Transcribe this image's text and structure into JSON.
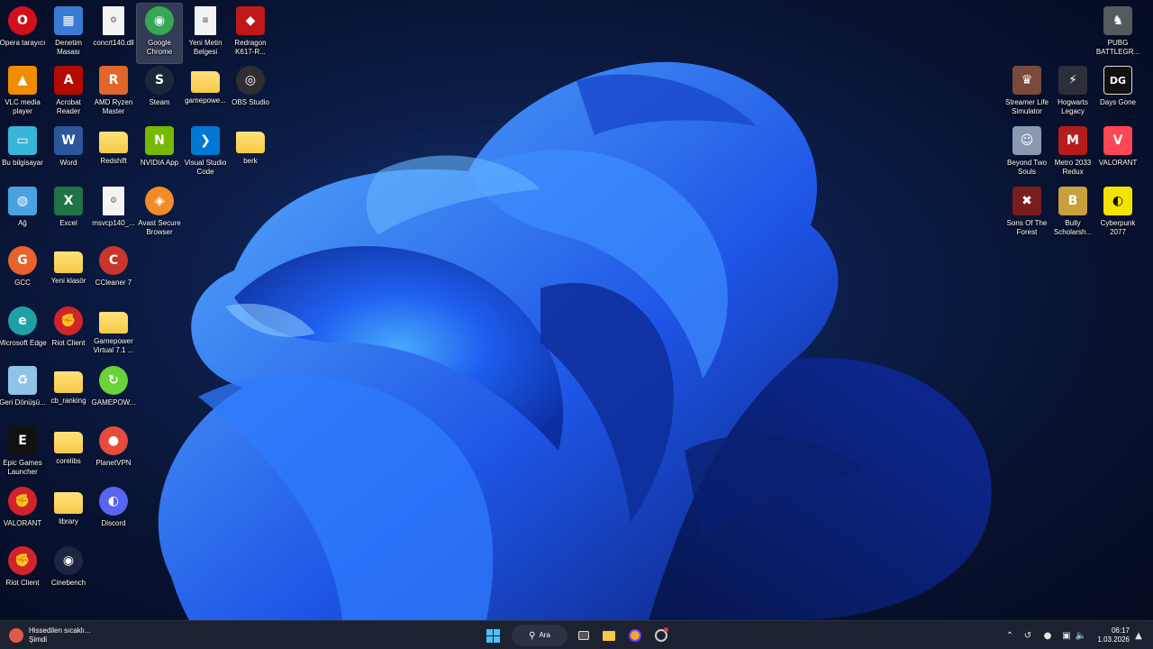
{
  "desktop": {
    "left_icons": [
      {
        "label": "Opera tarayıcı",
        "icon": "opera-icon"
      },
      {
        "label": "Denetim Masası",
        "icon": "control-panel-icon"
      },
      {
        "label": "concrt140.dll",
        "icon": "dll-file-icon"
      },
      {
        "label": "Google Chrome",
        "icon": "chrome-icon",
        "selected": true
      },
      {
        "label": "Yeni Metin Belgesi",
        "icon": "text-document-icon"
      },
      {
        "label": "Redragon K617-R...",
        "icon": "redragon-icon"
      },
      {
        "label": "VLC media player",
        "icon": "vlc-icon"
      },
      {
        "label": "Acrobat Reader",
        "icon": "acrobat-icon"
      },
      {
        "label": "AMD Ryzen Master",
        "icon": "amd-ryzen-icon"
      },
      {
        "label": "Steam",
        "icon": "steam-icon"
      },
      {
        "label": "gamepowe...",
        "icon": "archive-icon"
      },
      {
        "label": "OBS Studio",
        "icon": "obs-icon"
      },
      {
        "label": "Bu bilgisayar",
        "icon": "this-pc-icon"
      },
      {
        "label": "Word",
        "icon": "word-icon"
      },
      {
        "label": "Redshift",
        "icon": "folder-icon"
      },
      {
        "label": "NVIDIA App",
        "icon": "nvidia-icon"
      },
      {
        "label": "Visual Studio Code",
        "icon": "vscode-icon"
      },
      {
        "label": "berk",
        "icon": "folder-icon"
      },
      {
        "label": "Ağ",
        "icon": "network-icon"
      },
      {
        "label": "Excel",
        "icon": "excel-icon"
      },
      {
        "label": "msvcp140_...",
        "icon": "dll-file-icon"
      },
      {
        "label": "Avast Secure Browser",
        "icon": "avast-icon"
      },
      {
        "label": "GCC",
        "icon": "gcc-icon"
      },
      {
        "label": "Yeni klasör",
        "icon": "folder-icon"
      },
      {
        "label": "CCleaner 7",
        "icon": "ccleaner-icon"
      },
      {
        "label": "Microsoft Edge",
        "icon": "edge-icon"
      },
      {
        "label": "Riot Client",
        "icon": "riot-icon"
      },
      {
        "label": "Gamepower Virtual 7.1 ...",
        "icon": "folder-icon"
      },
      {
        "label": "Geri Dönüşü...",
        "icon": "recycle-bin-icon"
      },
      {
        "label": "cb_ranking",
        "icon": "folder-icon"
      },
      {
        "label": "GAMEPOW...",
        "icon": "gamepower-icon"
      },
      {
        "label": "Epic Games Launcher",
        "icon": "epic-games-icon"
      },
      {
        "label": "corelibs",
        "icon": "folder-icon"
      },
      {
        "label": "PlanetVPN",
        "icon": "planetvpn-icon"
      },
      {
        "label": "VALORANT",
        "icon": "riot-icon"
      },
      {
        "label": "library",
        "icon": "folder-icon"
      },
      {
        "label": "Discord",
        "icon": "discord-icon"
      },
      {
        "label": "Riot Client",
        "icon": "riot-icon"
      },
      {
        "label": "Cinebench",
        "icon": "cinebench-icon"
      }
    ],
    "right_icons": [
      {
        "label": "PUBG BATTLEGR...",
        "icon": "pubg-icon"
      },
      {
        "label": "Streamer Life Simulator",
        "icon": "streamer-life-icon"
      },
      {
        "label": "Hogwarts Legacy",
        "icon": "hogwarts-icon"
      },
      {
        "label": "Days Gone",
        "icon": "days-gone-icon"
      },
      {
        "label": "Beyond Two Souls",
        "icon": "beyond-two-souls-icon"
      },
      {
        "label": "Metro 2033 Redux",
        "icon": "metro-icon"
      },
      {
        "label": "VALORANT",
        "icon": "valorant-icon"
      },
      {
        "label": "Sons Of The Forest",
        "icon": "sons-forest-icon"
      },
      {
        "label": "Bully Scholarsh...",
        "icon": "bully-icon"
      },
      {
        "label": "Cyberpunk 2077",
        "icon": "cyberpunk-icon"
      }
    ]
  },
  "taskbar": {
    "weather_title": "Hissedilen sıcaklı...",
    "weather_sub": "Şimdi",
    "search_label": "Ara",
    "time": "06:17",
    "date": "1.03.2026"
  },
  "colors": {
    "taskbar_bg": "#1c2230",
    "accent": "#3b82f6"
  }
}
